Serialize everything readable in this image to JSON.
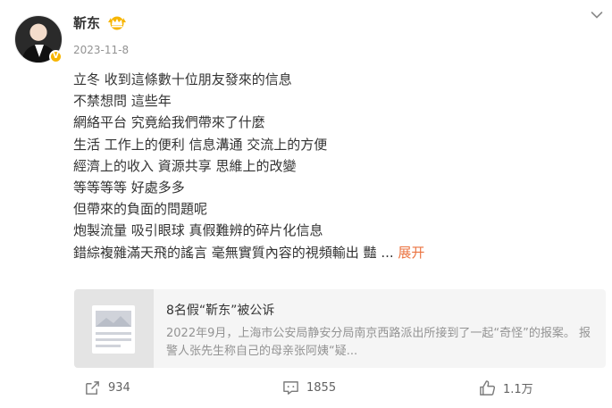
{
  "author": {
    "name": "靳东",
    "badge_icon": "crown-icon",
    "verified_icon": "verified-icon"
  },
  "post": {
    "date": "2023-11-8",
    "lines": [
      "立冬 收到這條數十位朋友發來的信息",
      "不禁想問 這些年",
      "網絡平台 究竟給我們帶來了什麼",
      "生活 工作上的便利 信息溝通 交流上的方便",
      "經濟上的收入 資源共享 思維上的改變",
      "等等等等 好處多多",
      "但帶來的負面的問題呢",
      "炮製流量 吸引眼球 真假難辨的碎片化信息",
      "錯綜複雜滿天飛的謠言 毫無實質內容的視頻輸出 豔"
    ],
    "ellipsis": "...",
    "expand_label": "展开"
  },
  "linked_card": {
    "title": "8名假“靳东”被公诉",
    "description": "2022年9月，上海市公安局静安分局南京西路派出所接到了一起“奇怪”的报案。 报警人张先生称自己的母亲张阿姨“疑..."
  },
  "actions": {
    "repost_count": "934",
    "comment_count": "1855",
    "like_count": "1.1万"
  },
  "colors": {
    "accent_link": "#eb7340",
    "text_primary": "#333333",
    "text_secondary": "#939393",
    "card_bg": "#f5f5f5"
  }
}
